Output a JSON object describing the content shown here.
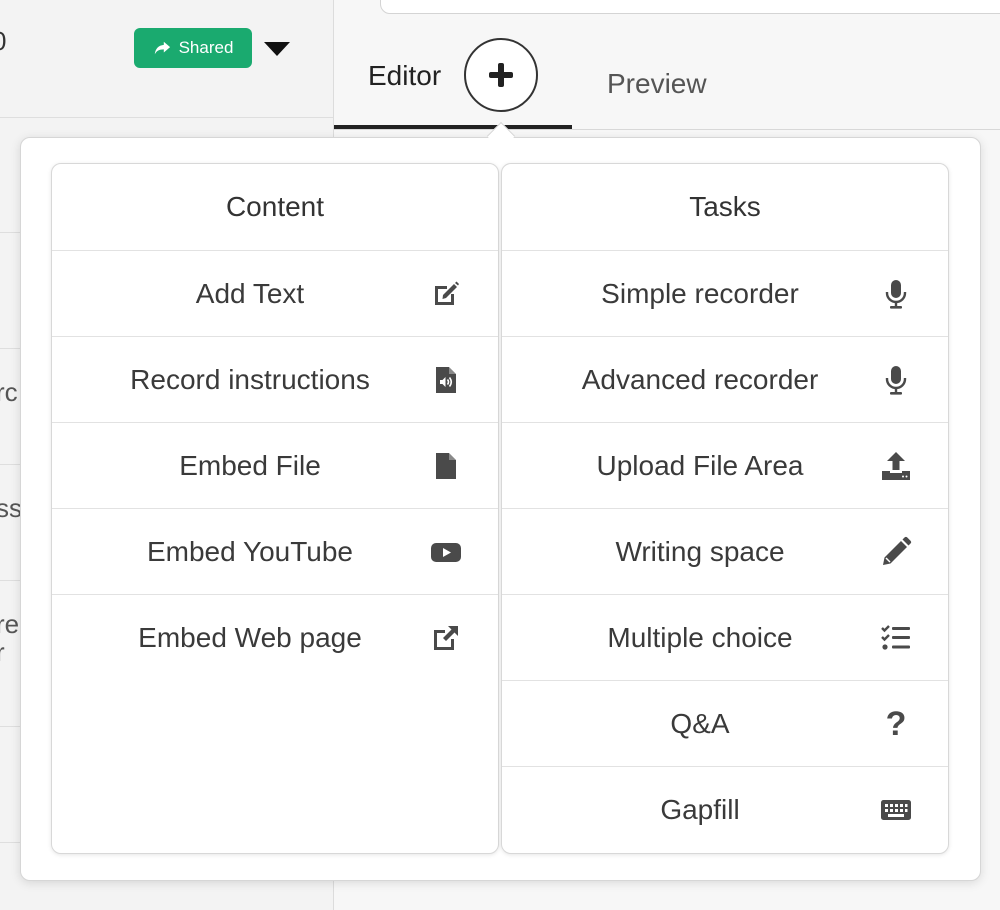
{
  "left_panel": {
    "number_fragment": "0",
    "shared_label": "Shared",
    "row_fragments": [
      "rc",
      "ss",
      "re",
      "r"
    ]
  },
  "tabs": {
    "editor_label": "Editor",
    "preview_label": "Preview"
  },
  "colors": {
    "accent_green": "#1aaa6f",
    "icon_gray": "#4a4a4a",
    "text_dark": "#333333"
  },
  "menu": {
    "content": {
      "title": "Content",
      "items": [
        {
          "label": "Add Text",
          "icon": "edit-icon"
        },
        {
          "label": "Record instructions",
          "icon": "audio-file-icon"
        },
        {
          "label": "Embed File",
          "icon": "file-icon"
        },
        {
          "label": "Embed YouTube",
          "icon": "youtube-icon"
        },
        {
          "label": "Embed Web page",
          "icon": "external-link-icon"
        }
      ]
    },
    "tasks": {
      "title": "Tasks",
      "items": [
        {
          "label": "Simple recorder",
          "icon": "microphone-icon"
        },
        {
          "label": "Advanced recorder",
          "icon": "microphone-icon"
        },
        {
          "label": "Upload File Area",
          "icon": "upload-icon"
        },
        {
          "label": "Writing space",
          "icon": "pencil-icon"
        },
        {
          "label": "Multiple choice",
          "icon": "checklist-icon"
        },
        {
          "label": "Q&A",
          "icon": "question-icon"
        },
        {
          "label": "Gapfill",
          "icon": "keyboard-icon"
        }
      ]
    }
  }
}
